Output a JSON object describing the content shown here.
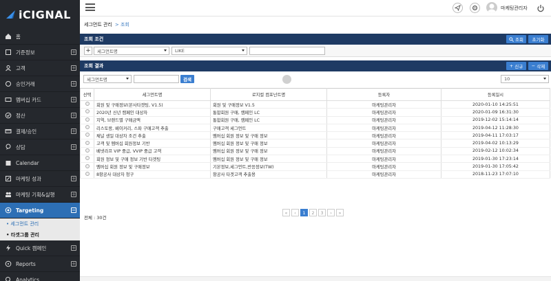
{
  "brand": {
    "logo_text": "iCIGNAL",
    "accent": "#2d6fb5",
    "sidebar_bg": "#25282d"
  },
  "sidebar": {
    "items": [
      {
        "label": "홈",
        "icon": "home-icon",
        "expand": false
      },
      {
        "label": "기준정보",
        "icon": "clipboard-icon",
        "expand": true
      },
      {
        "label": "고객",
        "icon": "users-icon",
        "expand": true
      },
      {
        "label": "승인거래",
        "icon": "card-icon",
        "expand": true
      },
      {
        "label": "멤버십 카드",
        "icon": "membership-card-icon",
        "expand": true
      },
      {
        "label": "정산",
        "icon": "check-circle-icon",
        "expand": true
      },
      {
        "label": "결제/승인",
        "icon": "payment-icon",
        "expand": true
      },
      {
        "label": "상담",
        "icon": "chat-icon",
        "expand": true
      },
      {
        "label": "Calendar",
        "icon": "calendar-icon",
        "expand": false
      },
      {
        "label": "마케팅 성과",
        "icon": "chart-icon",
        "expand": true
      },
      {
        "label": "마케팅 기획&실행",
        "icon": "people-icon",
        "expand": true
      },
      {
        "label": "Targeting",
        "icon": "target-icon",
        "expand": true,
        "active": true
      },
      {
        "label": "Quick 캠페인",
        "icon": "lightning-icon",
        "expand": true
      },
      {
        "label": "Reports",
        "icon": "report-icon",
        "expand": true
      },
      {
        "label": "Analytics",
        "icon": "analytics-icon",
        "expand": false
      }
    ],
    "sub_items": [
      "• 세그먼트 관리",
      "• 타겟그룹 관리"
    ]
  },
  "topbar": {
    "username": "마케팅관리자"
  },
  "breadcrumb": {
    "title": "세그먼트 관리",
    "current": "> 조회"
  },
  "search_panel": {
    "title": "조회 조건",
    "search_button": "조회",
    "reset_button": "초기화",
    "field_select": "세그먼트명",
    "operator_select": "LIKE",
    "value_input": ""
  },
  "result_panel": {
    "title": "조회 결과",
    "new_button": "신규",
    "delete_button": "삭제",
    "filter_select": "세그먼트명",
    "filter_input": "",
    "filter_button": "검색",
    "page_size": "10"
  },
  "table": {
    "columns": [
      "선택",
      "세그먼트명",
      "로지컬 컴포넌트명",
      "등록자",
      "등록일시"
    ],
    "rows": [
      [
        "회원 및 구매정보(본사타겟팅, V1.5)",
        "회원 및 구매정보 V1.5",
        "마케팅관리자",
        "2020-01-10 14:25:51"
      ],
      [
        "2020년 신년 캠페인 대상자",
        "통합회원 구매, 캠페인 LC",
        "마케팅관리자",
        "2020-01-09 16:31:30"
      ],
      [
        "지역, 브랜드별 구매금액",
        "통합회원 구매, 캠페인 LC",
        "마케팅관리자",
        "2019-12-02 15:14:14"
      ],
      [
        "리스토랑, 베이커리, 스파 구매고객 추출",
        "구매고객 세그먼트",
        "마케팅관리자",
        "2019-04-12 11:28:30"
      ],
      [
        "채널 생일 대상자 조건 추출",
        "멤버십 회원 정보 및 구매 정보",
        "마케팅관리자",
        "2019-04-11 17:03:17"
      ],
      [
        "고객 및 멤버십 회원정보 기반",
        "멤버십 회원 정보 및 구매 정보",
        "마케팅관리자",
        "2019-04-02 10:13:29"
      ],
      [
        "베넷라프 VIP 중급, VVIP 중급 고객",
        "멤버십 회원 정보 및 구매 정보",
        "마케팅관리자",
        "2019-02-12 10:02:34"
      ],
      [
        "회원 정보 및 구매 정보 기반 타겟팅",
        "멤버십 회원 정보 및 구매 정보",
        "마케팅관리자",
        "2019-01-30 17:23:14"
      ],
      [
        "멤버십 회원 정보 및 구매정보",
        "기본정보,세그먼트,반응정보(TW)",
        "마케팅관리자",
        "2019-01-30 17:05:42"
      ],
      [
        "8항공사 대상자 청구",
        "항공사 타겟고객 추출용",
        "마케팅관리자",
        "2018-11-23 17:07:10"
      ]
    ]
  },
  "pagination": {
    "pages": [
      "1",
      "2",
      "3"
    ],
    "current": "1"
  },
  "total_text": "전체 : 30건"
}
